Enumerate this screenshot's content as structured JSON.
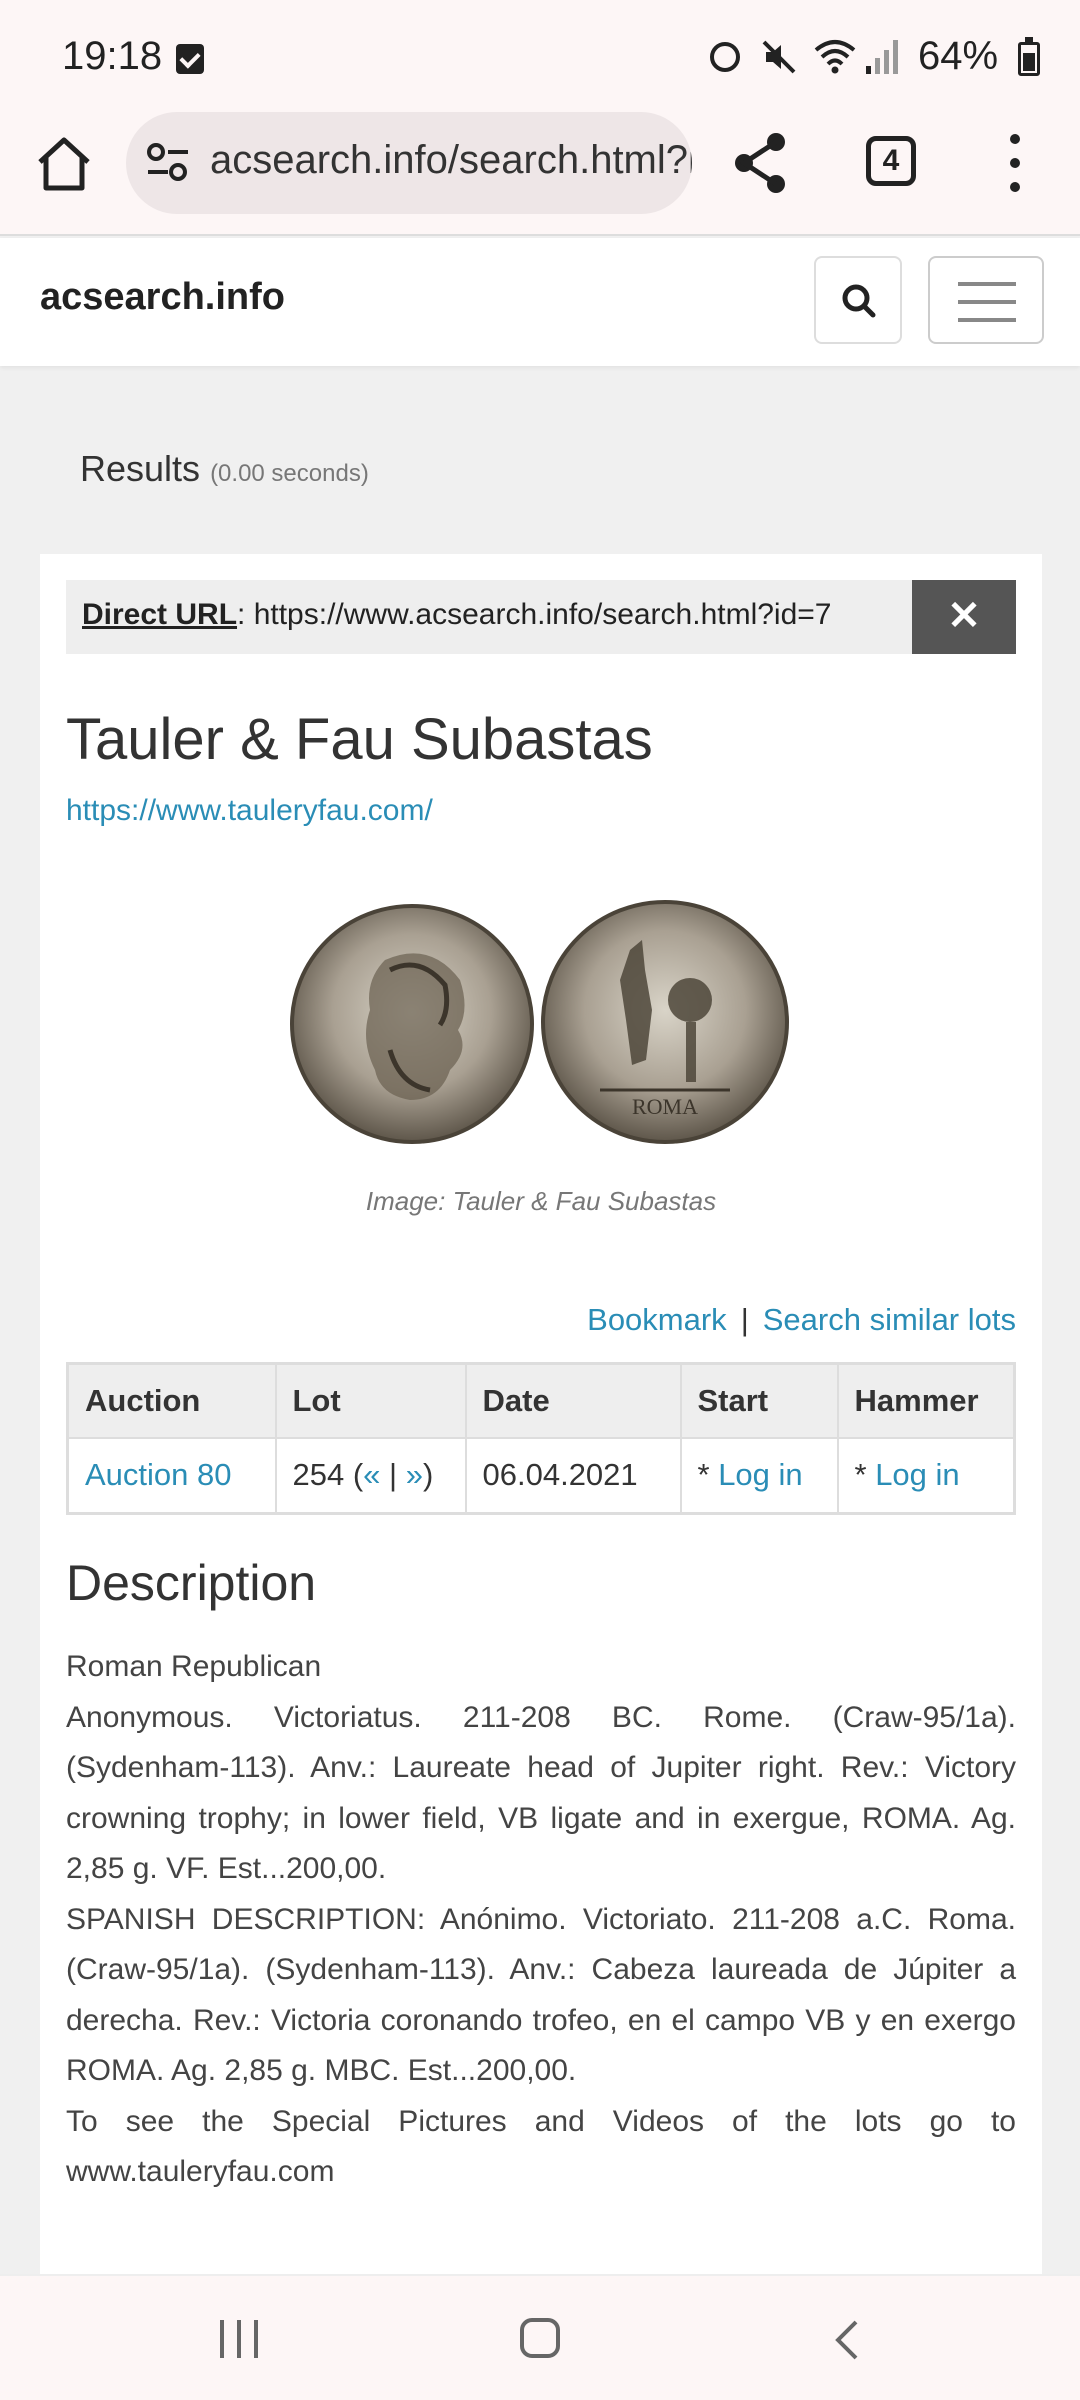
{
  "status": {
    "time": "19:18",
    "battery": "64%"
  },
  "browser": {
    "url": "acsearch.info/search.html?id=7",
    "tab_count": "4"
  },
  "site": {
    "brand": "acsearch.info"
  },
  "results": {
    "title": "Results",
    "time": "(0.00 seconds)"
  },
  "direct_url": {
    "label": "Direct URL",
    "value": ": https://www.acsearch.info/search.html?id=7",
    "close": "✕"
  },
  "lot": {
    "auction_house": "Tauler & Fau Subastas",
    "house_url": "https://www.tauleryfau.com/",
    "image_caption": "Image: Tauler & Fau Subastas",
    "bookmark": "Bookmark",
    "separator": "|",
    "search_similar": "Search similar lots"
  },
  "table": {
    "headers": [
      "Auction",
      "Lot",
      "Date",
      "Start",
      "Hammer"
    ],
    "row": {
      "auction": "Auction 80",
      "lot": "254",
      "lot_prev": "«",
      "lot_next": "»",
      "date": "06.04.2021",
      "start_prefix": "* ",
      "start": "Log in",
      "hammer_prefix": "* ",
      "hammer": "Log in"
    }
  },
  "description": {
    "title": "Description",
    "lines": [
      "Roman Republican",
      "Anonymous. Victoriatus. 211-208 BC. Rome. (Craw-95/1a). (Sydenham-113). Anv.: Laureate head of Jupiter right. Rev.: Victory crowning trophy; in lower field, VB ligate and in exergue, ROMA. Ag. 2,85 g. VF. Est...200,00.",
      "SPANISH DESCRIPTION: Anónimo. Victoriato. 211-208 a.C. Roma. (Craw-95/1a). (Sydenham-113). Anv.: Cabeza laureada de Júpiter a derecha. Rev.: Victoria coronando trofeo, en el campo VB y en exergo ROMA. Ag. 2,85 g. MBC. Est...200,00.",
      "To see the Special Pictures and Videos of the lots go to www.tauleryfau.com"
    ]
  },
  "coin_reverse_legend": "ROMA"
}
